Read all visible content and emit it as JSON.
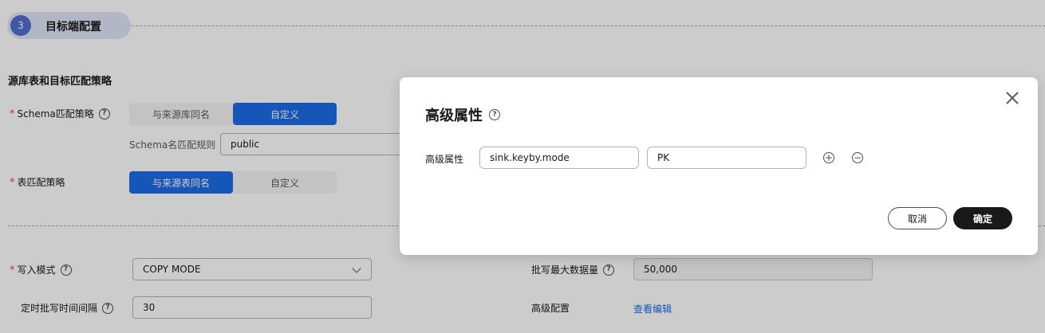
{
  "step": {
    "number": "3",
    "title": "目标端配置"
  },
  "section": {
    "title": "源库表和目标匹配策略"
  },
  "schema_strategy": {
    "required_mark": "*",
    "label": "Schema匹配策略",
    "options": [
      "与来源库同名",
      "自定义"
    ],
    "selected": "自定义",
    "rule_label": "Schema名匹配规则",
    "rule_value": "public"
  },
  "table_strategy": {
    "required_mark": "*",
    "label": "表匹配策略",
    "options": [
      "与来源表同名",
      "自定义"
    ],
    "selected": "与来源表同名"
  },
  "write_mode": {
    "required_mark": "*",
    "label": "写入模式",
    "value": "COPY MODE"
  },
  "batch_interval": {
    "label": "定时批写时间间隔",
    "value": "30"
  },
  "batch_max": {
    "label": "批写最大数据量",
    "value": "50,000"
  },
  "advanced_config": {
    "label": "高级配置",
    "link": "查看编辑"
  },
  "help_glyph": "?",
  "dialog": {
    "title": "高级属性",
    "property_label": "高级属性",
    "key_value": "sink.keyby.mode",
    "value_value": "PK",
    "add_glyph": "+",
    "remove_glyph": "−",
    "cancel_label": "取消",
    "ok_label": "确定"
  },
  "colors": {
    "primary": "#1d6ce8",
    "step_badge": "#526ecc",
    "required": "#e54545",
    "dark_button": "#191919"
  }
}
